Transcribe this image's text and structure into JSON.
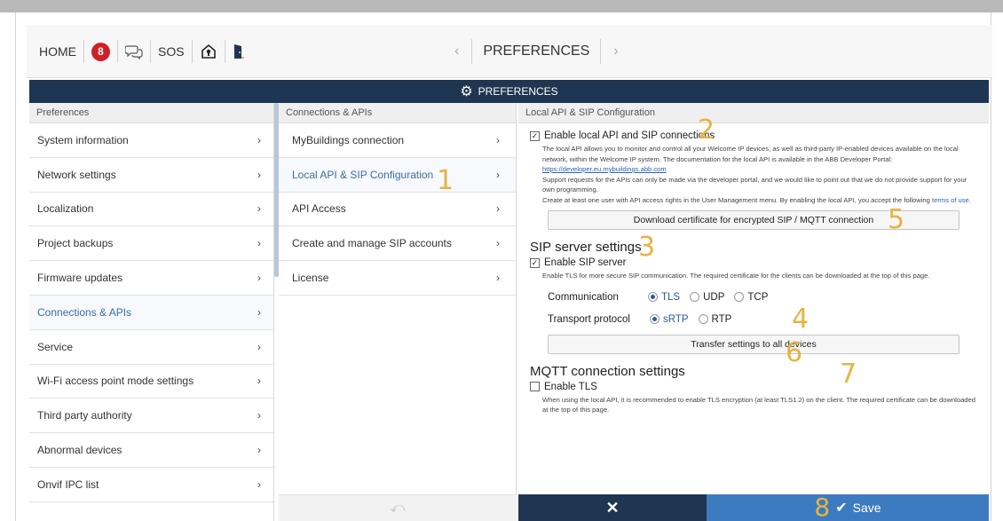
{
  "topnav": {
    "home_label": "HOME",
    "badge_count": "8",
    "sos_label": "SOS",
    "title": "PREFERENCES",
    "prev_icon": "chevron-left-icon",
    "next_icon": "chevron-right-icon"
  },
  "header": {
    "title": "PREFERENCES",
    "icon": "gear-icon"
  },
  "columns": {
    "col1_head": "Preferences",
    "col2_head": "Connections & APIs",
    "col3_head": "Local API & SIP Configuration"
  },
  "preferences_list": [
    {
      "label": "System information"
    },
    {
      "label": "Network settings"
    },
    {
      "label": "Localization"
    },
    {
      "label": "Project backups"
    },
    {
      "label": "Firmware updates"
    },
    {
      "label": "Connections & APIs"
    },
    {
      "label": "Service"
    },
    {
      "label": "Wi-Fi access point mode settings"
    },
    {
      "label": "Third party authority"
    },
    {
      "label": "Abnormal devices"
    },
    {
      "label": "Onvif IPC list"
    }
  ],
  "connections_list": [
    {
      "label": "MyBuildings connection"
    },
    {
      "label": "Local API & SIP Configuration"
    },
    {
      "label": "API Access"
    },
    {
      "label": "Create and manage SIP accounts"
    },
    {
      "label": "License"
    }
  ],
  "local_api": {
    "enable_label": "Enable local API and SIP connections",
    "desc1": "The local API allows you to monitor and control all your Welcome IP devices, as well as third-party IP-enabled devices available on the local network, within the Welcome IP system. The documentation for the local API is available in the ABB Developer Portal: ",
    "portal_link": "https://developer.eu.mybuildings.abb.com",
    "desc2": "Support requests for the APIs can only be made via the developer portal, and we would like to point out that we do not provide support for your own programming.",
    "desc3": "Create at least one user with API access rights in the User Management menu. By enabling the local API, you accept the following ",
    "terms_link": "terms of use",
    "desc3_end": ".",
    "download_button": "Download certificate for encrypted SIP / MQTT connection"
  },
  "sip": {
    "title": "SIP server settings",
    "enable_label": "Enable SIP server",
    "desc": "Enable TLS for more secure SIP communication. The required certificate for the clients can be downloaded at the top of this page.",
    "communication_label": "Communication",
    "communication_options": [
      "TLS",
      "UDP",
      "TCP"
    ],
    "communication_selected": "TLS",
    "transport_label": "Transport protocol",
    "transport_options": [
      "sRTP",
      "RTP"
    ],
    "transport_selected": "sRTP",
    "transfer_button": "Transfer settings to all devices"
  },
  "mqtt": {
    "title": "MQTT connection settings",
    "enable_label": "Enable TLS",
    "desc": "When using the local API, it is recommended to enable TLS encryption (at least TLS1.2) on the client. The required certificate can be downloaded at the top of this page."
  },
  "footer": {
    "cancel_symbol": "✕",
    "save_label": "Save"
  },
  "annotations": [
    "1",
    "2",
    "3",
    "4",
    "5",
    "6",
    "7",
    "8"
  ],
  "colors": {
    "header": "#1e3652",
    "save": "#3d7bc1",
    "annotation": "#e8b340",
    "badge": "#d11f26"
  }
}
